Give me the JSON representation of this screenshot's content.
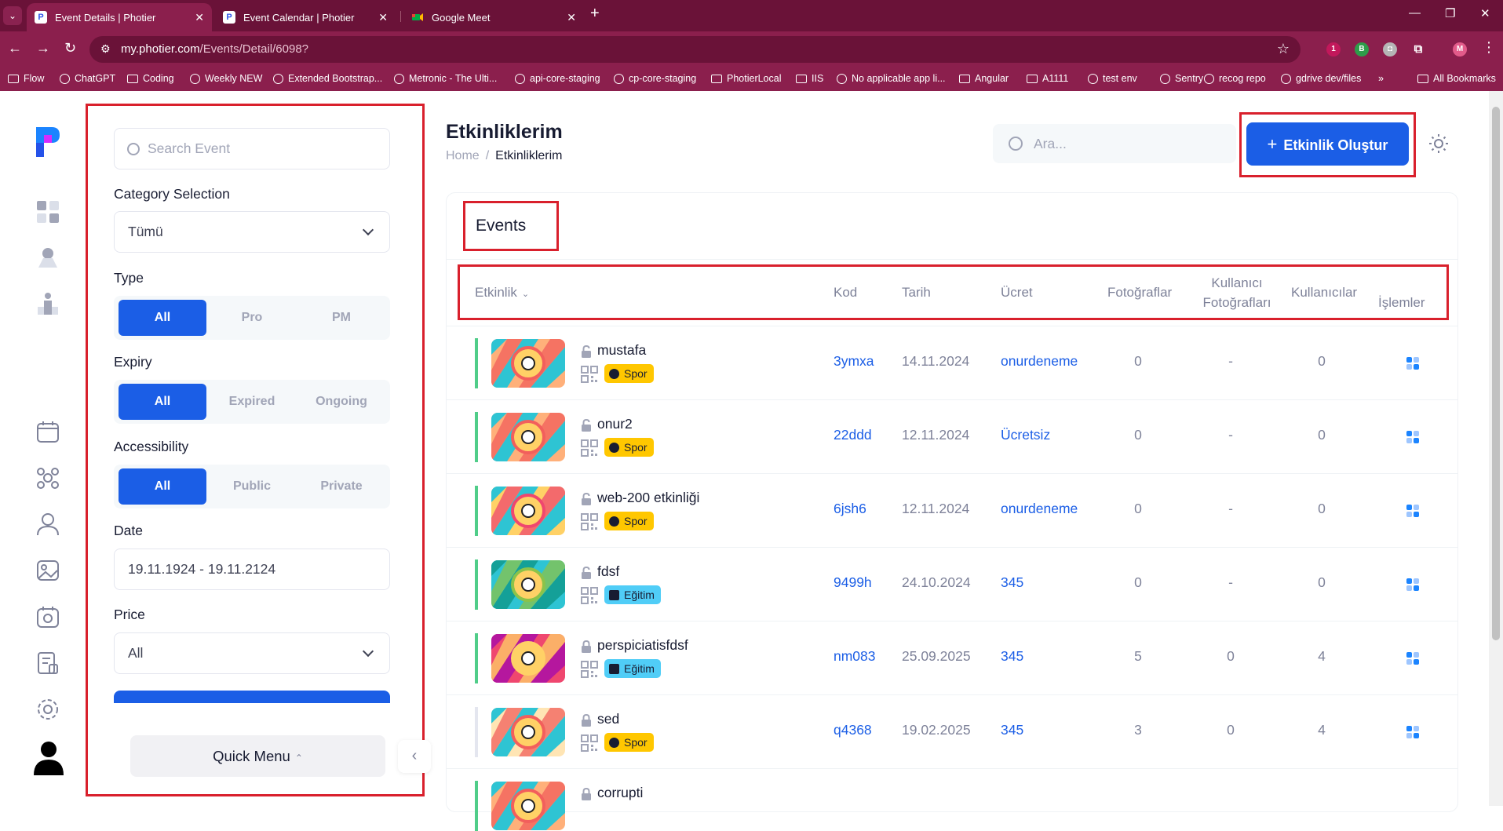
{
  "browser": {
    "tabs": [
      {
        "title": "Event Details | Photier",
        "active": true
      },
      {
        "title": "Event Calendar | Photier",
        "active": false
      },
      {
        "title": "Google Meet",
        "active": false
      }
    ],
    "url_host": "my.photier.com",
    "url_path": "/Events/Detail/6098?",
    "profile_initial": "M",
    "bookmarks": [
      "Flow",
      "ChatGPT",
      "Coding",
      "Weekly NEW",
      "Extended Bootstrap...",
      "Metronic - The Ulti...",
      "api-core-staging",
      "cp-core-staging",
      "PhotierLocal",
      "IIS",
      "No applicable app li...",
      "Angular",
      "A1111",
      "test env",
      "Sentry",
      "recog repo",
      "gdrive dev/files",
      "All Bookmarks"
    ],
    "chrome_color": "#8b1f4d"
  },
  "sidebar": {
    "search_placeholder": "Search Event",
    "category_label": "Category Selection",
    "category_value": "Tümü",
    "type_label": "Type",
    "type_options": [
      "All",
      "Pro",
      "PM"
    ],
    "expiry_label": "Expiry",
    "expiry_options": [
      "All",
      "Expired",
      "Ongoing"
    ],
    "accessibility_label": "Accessibility",
    "accessibility_options": [
      "All",
      "Public",
      "Private"
    ],
    "date_label": "Date",
    "date_value": "19.11.1924 - 19.11.2124",
    "price_label": "Price",
    "price_value": "All",
    "quick_menu_label": "Quick Menu",
    "accent": "#1b5ee6"
  },
  "header": {
    "title": "Etkinliklerim",
    "breadcrumb_home": "Home",
    "breadcrumb_sep": "/",
    "breadcrumb_current": "Etkinliklerim",
    "search_placeholder": "Ara...",
    "create_button": "Etkinlik Oluştur"
  },
  "events": {
    "card_title": "Events",
    "columns": [
      "Etkinlik",
      "Kod",
      "Tarih",
      "Ücret",
      "Fotoğraflar",
      "Kullanıcı Fotoğrafları",
      "Kullanıcılar",
      "İşlemler"
    ],
    "rows": [
      {
        "name": "mustafa",
        "category": "Spor",
        "code": "3ymxa",
        "date": "14.11.2024",
        "fee": "onurdeneme",
        "photos": "0",
        "user_photos": "-",
        "users": "0",
        "status": "#50cd89",
        "locked": false
      },
      {
        "name": "onur2",
        "category": "Spor",
        "code": "22ddd",
        "date": "12.11.2024",
        "fee": "Ücretsiz",
        "photos": "0",
        "user_photos": "-",
        "users": "0",
        "status": "#50cd89",
        "locked": false
      },
      {
        "name": "web-200 etkinliği",
        "category": "Spor",
        "code": "6jsh6",
        "date": "12.11.2024",
        "fee": "onurdeneme",
        "photos": "0",
        "user_photos": "-",
        "users": "0",
        "status": "#50cd89",
        "locked": false
      },
      {
        "name": "fdsf",
        "category": "Eğitim",
        "code": "9499h",
        "date": "24.10.2024",
        "fee": "345",
        "photos": "0",
        "user_photos": "-",
        "users": "0",
        "status": "#50cd89",
        "locked": false
      },
      {
        "name": "perspiciatisfdsf",
        "category": "Eğitim",
        "code": "nm083",
        "date": "25.09.2025",
        "fee": "345",
        "photos": "5",
        "user_photos": "0",
        "users": "4",
        "status": "#50cd89",
        "locked": true
      },
      {
        "name": "sed",
        "category": "Spor",
        "code": "q4368",
        "date": "19.02.2025",
        "fee": "345",
        "photos": "3",
        "user_photos": "0",
        "users": "4",
        "status": "#e4e6ef",
        "locked": true
      },
      {
        "name": "corrupti",
        "category": "",
        "code": "",
        "date": "",
        "fee": "",
        "photos": "",
        "user_photos": "",
        "users": "",
        "status": "#50cd89",
        "locked": true
      }
    ]
  },
  "annotation_color": "#d9202c"
}
